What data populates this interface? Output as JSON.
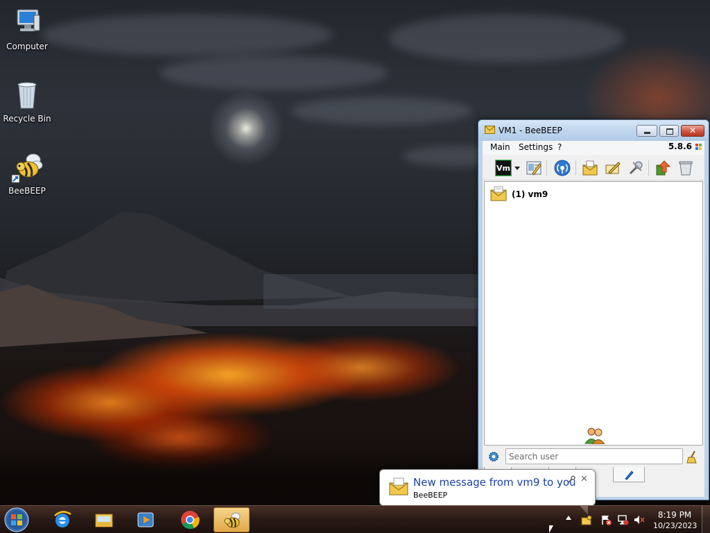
{
  "desktop": {
    "icons": [
      {
        "label": "Computer",
        "icon": "computer-icon"
      },
      {
        "label": "Recycle Bin",
        "icon": "recycle-bin-icon"
      },
      {
        "label": "BeeBEEP",
        "icon": "bee-icon"
      }
    ]
  },
  "window": {
    "title": "VM1 - BeeBEEP",
    "menu": {
      "main": "Main",
      "settings": "Settings",
      "help": "?"
    },
    "version": "5.8.6",
    "toolbar": {
      "status_badge": "Vm",
      "icons": [
        "vm-status-icon",
        "dropdown-arrow-icon",
        "edit-profile-icon",
        "network-icon",
        "messages-icon",
        "write-message-icon",
        "plugins-icon",
        "update-icon",
        "trash-icon"
      ]
    },
    "chats": [
      {
        "label": "(1) vm9",
        "icon": "envelope-icon"
      }
    ],
    "search": {
      "placeholder": "Search user",
      "value": ""
    }
  },
  "notification": {
    "title": "New message from vm9 to you",
    "subtitle": "BeeBEEP",
    "close": "✕"
  },
  "taskbar": {
    "apps": [
      "start-orb",
      "internet-explorer",
      "file-explorer",
      "media-player",
      "chrome",
      "beebeep"
    ],
    "clock": {
      "time": "8:19 PM",
      "date": "10/23/2023"
    }
  },
  "colors": {
    "accent_link": "#1c3ea6",
    "close_button": "#c7412c"
  }
}
